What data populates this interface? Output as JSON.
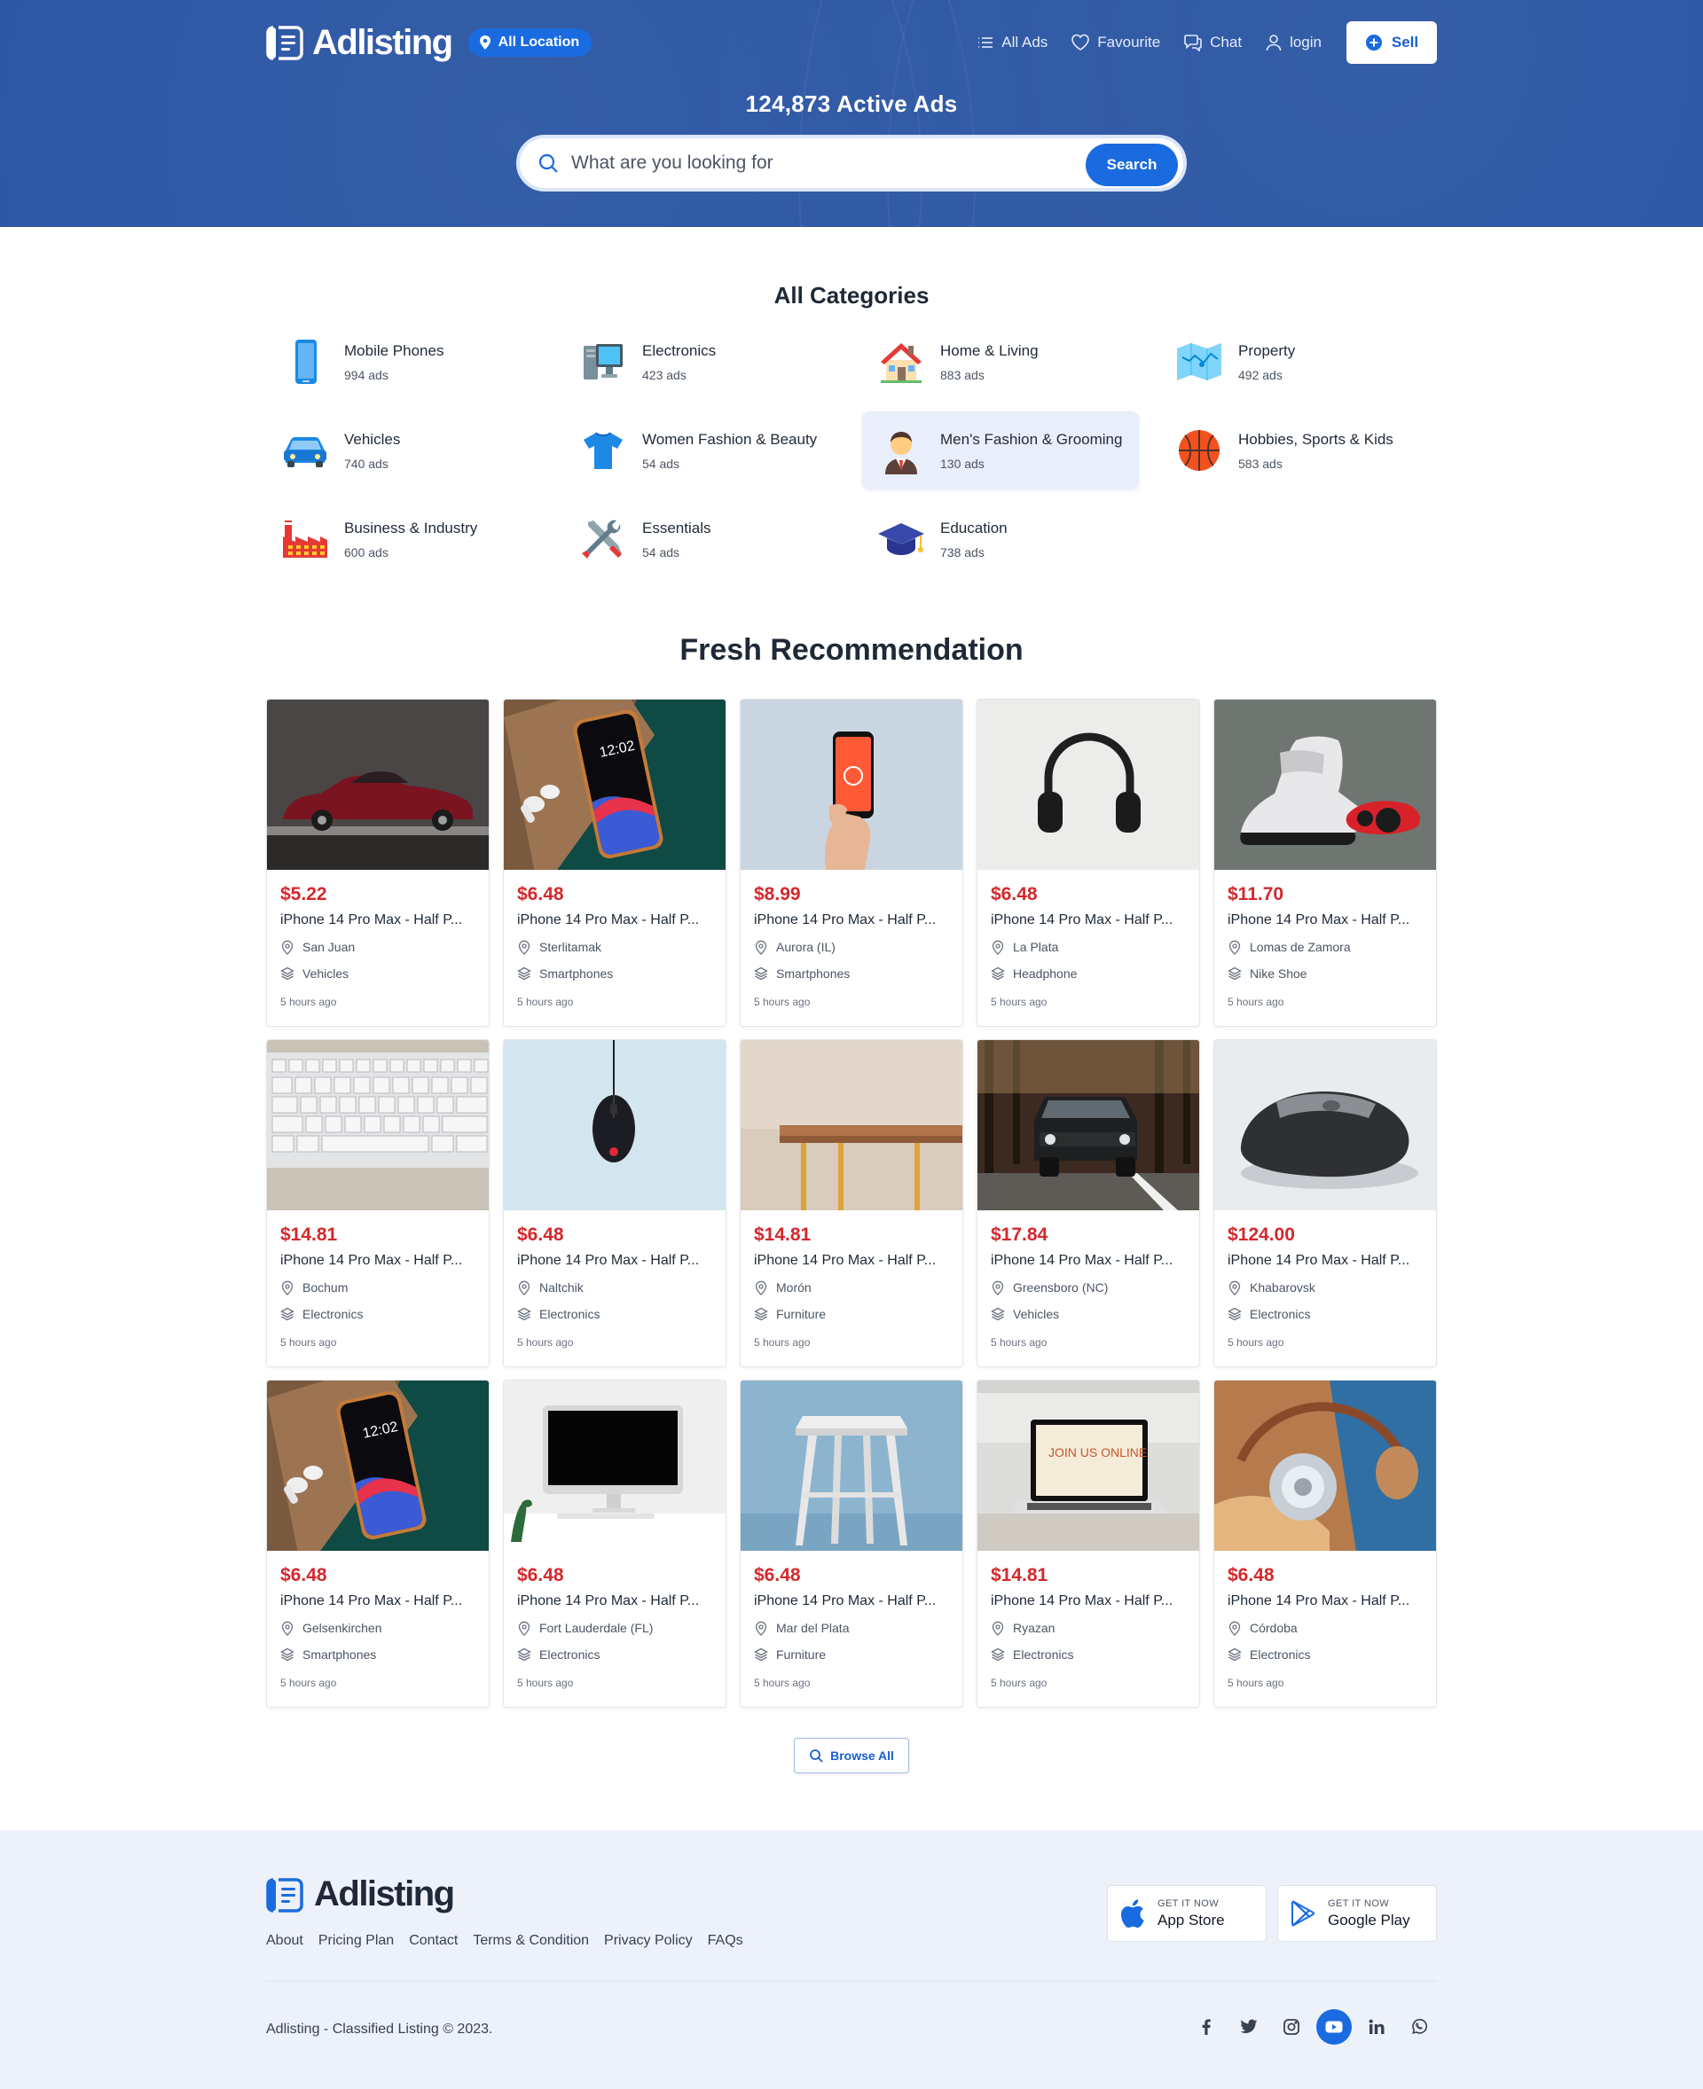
{
  "header": {
    "brand": "Adlisting",
    "location_label": "All Location",
    "nav": [
      {
        "label": "All Ads",
        "icon": "list-icon"
      },
      {
        "label": "Favourite",
        "icon": "heart-icon"
      },
      {
        "label": "Chat",
        "icon": "chat-icon"
      },
      {
        "label": "login",
        "icon": "user-icon"
      }
    ],
    "sell_label": "Sell",
    "active_ads": "124,873 Active Ads",
    "search": {
      "placeholder": "What are you looking for",
      "button": "Search"
    }
  },
  "categories": {
    "title": "All Categories",
    "items": [
      {
        "name": "Mobile Phones",
        "count": "994 ads",
        "icon": "mobile-phone-icon"
      },
      {
        "name": "Electronics",
        "count": "423 ads",
        "icon": "computer-icon"
      },
      {
        "name": "Home & Living",
        "count": "883 ads",
        "icon": "house-icon"
      },
      {
        "name": "Property",
        "count": "492 ads",
        "icon": "map-icon"
      },
      {
        "name": "Vehicles",
        "count": "740 ads",
        "icon": "car-icon"
      },
      {
        "name": "Women Fashion & Beauty",
        "count": "54 ads",
        "icon": "tshirt-icon"
      },
      {
        "name": "Men's Fashion & Grooming",
        "count": "130 ads",
        "icon": "man-icon",
        "active": true
      },
      {
        "name": "Hobbies, Sports & Kids",
        "count": "583 ads",
        "icon": "basketball-icon"
      },
      {
        "name": "Business & Industry",
        "count": "600 ads",
        "icon": "factory-icon"
      },
      {
        "name": "Essentials",
        "count": "54 ads",
        "icon": "tools-icon"
      },
      {
        "name": "Education",
        "count": "738 ads",
        "icon": "graduation-cap-icon"
      }
    ]
  },
  "fresh": {
    "title": "Fresh Recommendation",
    "listings": [
      {
        "price": "$5.22",
        "title": "iPhone 14 Pro Max - Half P...",
        "location": "San Juan",
        "category": "Vehicles",
        "time": "5 hours ago",
        "image": "red-classic-car"
      },
      {
        "price": "$6.48",
        "title": "iPhone 14 Pro Max - Half P...",
        "location": "Sterlitamak",
        "category": "Smartphones",
        "time": "5 hours ago",
        "image": "iphone-on-wood"
      },
      {
        "price": "$8.99",
        "title": "iPhone 14 Pro Max - Half P...",
        "location": "Aurora (IL)",
        "category": "Smartphones",
        "time": "5 hours ago",
        "image": "hand-holding-phone"
      },
      {
        "price": "$6.48",
        "title": "iPhone 14 Pro Max - Half P...",
        "location": "La Plata",
        "category": "Headphone",
        "time": "5 hours ago",
        "image": "black-headphones"
      },
      {
        "price": "$11.70",
        "title": "iPhone 14 Pro Max - Half P...",
        "location": "Lomas de Zamora",
        "category": "Nike Shoe",
        "time": "5 hours ago",
        "image": "sneakers"
      },
      {
        "price": "$14.81",
        "title": "iPhone 14 Pro Max - Half P...",
        "location": "Bochum",
        "category": "Electronics",
        "time": "5 hours ago",
        "image": "keyboard"
      },
      {
        "price": "$6.48",
        "title": "iPhone 14 Pro Max - Half P...",
        "location": "Naltchik",
        "category": "Electronics",
        "time": "5 hours ago",
        "image": "hanging-mouse"
      },
      {
        "price": "$14.81",
        "title": "iPhone 14 Pro Max - Half P...",
        "location": "Morón",
        "category": "Furniture",
        "time": "5 hours ago",
        "image": "wooden-table"
      },
      {
        "price": "$17.84",
        "title": "iPhone 14 Pro Max - Half P...",
        "location": "Greensboro (NC)",
        "category": "Vehicles",
        "time": "5 hours ago",
        "image": "suv-forest"
      },
      {
        "price": "$124.00",
        "title": "iPhone 14 Pro Max - Half P...",
        "location": "Khabarovsk",
        "category": "Electronics",
        "time": "5 hours ago",
        "image": "grey-mouse"
      },
      {
        "price": "$6.48",
        "title": "iPhone 14 Pro Max - Half P...",
        "location": "Gelsenkirchen",
        "category": "Smartphones",
        "time": "5 hours ago",
        "image": "iphone-on-wood"
      },
      {
        "price": "$6.48",
        "title": "iPhone 14 Pro Max - Half P...",
        "location": "Fort Lauderdale (FL)",
        "category": "Electronics",
        "time": "5 hours ago",
        "image": "imac-desk"
      },
      {
        "price": "$6.48",
        "title": "iPhone 14 Pro Max - Half P...",
        "location": "Mar del Plata",
        "category": "Furniture",
        "time": "5 hours ago",
        "image": "white-stool"
      },
      {
        "price": "$14.81",
        "title": "iPhone 14 Pro Max - Half P...",
        "location": "Ryazan",
        "category": "Electronics",
        "time": "5 hours ago",
        "image": "laptop-join-us"
      },
      {
        "price": "$6.48",
        "title": "iPhone 14 Pro Max - Half P...",
        "location": "Córdoba",
        "category": "Electronics",
        "time": "5 hours ago",
        "image": "orange-headphones"
      }
    ],
    "browse_label": "Browse All"
  },
  "footer": {
    "brand": "Adlisting",
    "links": [
      "About",
      "Pricing Plan",
      "Contact",
      "Terms & Condition",
      "Privacy Policy",
      "FAQs"
    ],
    "stores": [
      {
        "small": "GET IT NOW",
        "big": "App Store",
        "icon": "apple-icon"
      },
      {
        "small": "GET IT NOW",
        "big": "Google Play",
        "icon": "google-play-icon"
      }
    ],
    "copyright": "Adlisting - Classified Listing © 2023.",
    "socials": [
      "facebook-icon",
      "twitter-icon",
      "instagram-icon",
      "youtube-icon",
      "linkedin-icon",
      "whatsapp-icon"
    ]
  },
  "colors": {
    "brand_blue": "#2a55a3",
    "accent_blue": "#1a6be0",
    "price_red": "#d4282d",
    "footer_bg": "#edf1fa"
  }
}
